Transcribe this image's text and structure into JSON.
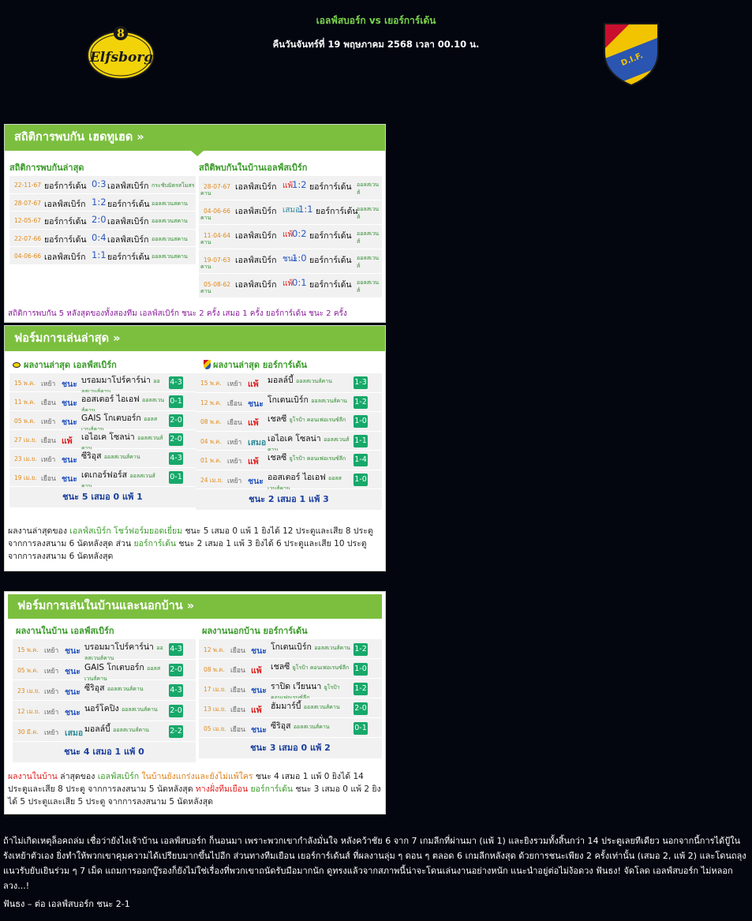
{
  "header": {
    "title": "เอลฟ์สบอร์ก vs เยอร์การ์เด้น",
    "datetime": "คืนวันจันทร์ที่ 19 พฤษภาคม 2568 เวลา 00.10 น.",
    "home_logo": "elfsborg-crest",
    "away_logo": "djurgarden-dif-crest",
    "home_logo_text": "Elfsborg",
    "away_logo_text": "D.I.F."
  },
  "h2h": {
    "heading": "สถิติการพบกัน เฮดทูเฮด »",
    "left_title": "สถิติการพบกันล่าสุด",
    "right_title": "สถิติพบกันในบ้านเอลฟ์สเบิร์ก",
    "left_rows": [
      {
        "date": "22-11-67",
        "home": "ยอร์การ์เด้น",
        "score": "0:3",
        "away": "เอลฟ์สเบิร์ก",
        "comp": "กระชับมิตรสโมสร"
      },
      {
        "date": "28-07-67",
        "home": "เอลฟ์สเบิร์ก",
        "score": "1:2",
        "away": "ยอร์การ์เด้น",
        "comp": "ออลสเวนสคาน"
      },
      {
        "date": "12-05-67",
        "home": "ยอร์การ์เด้น",
        "score": "2:0",
        "away": "เอลฟ์สเบิร์ก",
        "comp": "ออลสเวนสคาน"
      },
      {
        "date": "22-07-66",
        "home": "ยอร์การ์เด้น",
        "score": "0:4",
        "away": "เอลฟ์สเบิร์ก",
        "comp": "ออลสเวนสคาน"
      },
      {
        "date": "04-06-66",
        "home": "เอลฟ์สเบิร์ก",
        "score": "1:1",
        "away": "ยอร์การ์เด้น",
        "comp": "ออลสเวนสคาน"
      }
    ],
    "right_rows": [
      {
        "date": "28-07-67",
        "home": "เอลฟ์สเบิร์ก",
        "result": "แพ้",
        "res": "loss",
        "score": "1:2",
        "away": "ยอร์การ์เด้น",
        "comp1": "ออลสเวนส์",
        "comp2": "คาน"
      },
      {
        "date": "04-06-66",
        "home": "เอลฟ์สเบิร์ก",
        "result": "เสมอ",
        "res": "draw",
        "score": "1:1",
        "away": "ยอร์การ์เด้น",
        "comp1": "ออลสเวนส์",
        "comp2": "คาน"
      },
      {
        "date": "11-04-64",
        "home": "เอลฟ์สเบิร์ก",
        "result": "แพ้",
        "res": "loss",
        "score": "0:2",
        "away": "ยอร์การ์เด้น",
        "comp1": "ออลสเวนส์",
        "comp2": "คาน"
      },
      {
        "date": "19-07-63",
        "home": "เอลฟ์สเบิร์ก",
        "result": "ชนะ",
        "res": "win",
        "score": "1:0",
        "away": "ยอร์การ์เด้น",
        "comp1": "ออลสเวนส์",
        "comp2": "คาน"
      },
      {
        "date": "05-08-62",
        "home": "เอลฟ์สเบิร์ก",
        "result": "แพ้",
        "res": "loss",
        "score": "0:1",
        "away": "ยอร์การ์เด้น",
        "comp1": "ออลสเวนส์",
        "comp2": "คาน"
      }
    ],
    "summary": "สถิติการพบกัน 5 หลังสุดของทั้งสองทีม เอลฟ์สเบิร์ก ชนะ 2 ครั้ง เสมอ 1 ครั้ง ยอร์การ์เด้น ชนะ 2 ครั้ง"
  },
  "form": {
    "heading": "ฟอร์มการเล่นล่าสุด »",
    "left_title": "ผลงานล่าสุด เอลฟ์สเบิร์ก",
    "right_title": "ผลงานล่าสุด ยอร์การ์เด้น",
    "left_rows": [
      {
        "date": "15 พ.ค.",
        "ha": "เหย้า",
        "result": "ชนะ",
        "res": "win",
        "opp": "บรอมมาโปร์คาร์น่า",
        "comp": "ออลสเวนส์คาน",
        "score": "4-3"
      },
      {
        "date": "11 พ.ค.",
        "ha": "เยือน",
        "result": "ชนะ",
        "res": "win",
        "opp": "ออสเตอร์ ไอเอฟ",
        "comp": "ออลสเวนส์คาน",
        "score": "0-1"
      },
      {
        "date": "05 พ.ค.",
        "ha": "เหย้า",
        "result": "ชนะ",
        "res": "win",
        "opp": "GAIS โกเตบอร์ก",
        "comp": "ออลสเวนส์คาน",
        "score": "2-0"
      },
      {
        "date": "27 เม.ย.",
        "ha": "เยือน",
        "result": "แพ้",
        "res": "loss",
        "opp": "เอไอเค โซลน่า",
        "comp": "ออลสเวนส์คาน",
        "score": "2-0"
      },
      {
        "date": "23 เม.ย.",
        "ha": "เหย้า",
        "result": "ชนะ",
        "res": "win",
        "opp": "ซีริอุส",
        "comp": "ออลสเวนส์คาน",
        "score": "4-3"
      },
      {
        "date": "19 เม.ย.",
        "ha": "เยือน",
        "result": "ชนะ",
        "res": "win",
        "opp": "เดเกอร์ฟอร์ส",
        "comp": "ออลสเวนส์คาน",
        "score": "0-1"
      }
    ],
    "right_rows": [
      {
        "date": "15 พ.ค.",
        "ha": "เหย้า",
        "result": "แพ้",
        "res": "loss",
        "opp": "มอลล์บี้",
        "comp": "ออลสเวนส์คาน",
        "score": "1-3"
      },
      {
        "date": "12 พ.ค.",
        "ha": "เยือน",
        "result": "ชนะ",
        "res": "win",
        "opp": "โกเตนเบิร์ก",
        "comp": "ออลสเวนส์คาน",
        "score": "1-2"
      },
      {
        "date": "08 พ.ค.",
        "ha": "เยือน",
        "result": "แพ้",
        "res": "loss",
        "opp": "เชลซี",
        "comp": "ยูโรป้า คอนเฟอเรนซ์ลีก",
        "score": "1-0"
      },
      {
        "date": "04 พ.ค.",
        "ha": "เหย้า",
        "result": "เสมอ",
        "res": "draw",
        "opp": "เอไอเค โซลน่า",
        "comp": "ออลสเวนส์คาน",
        "score": "1-1"
      },
      {
        "date": "01 พ.ค.",
        "ha": "เหย้า",
        "result": "แพ้",
        "res": "loss",
        "opp": "เชลซี",
        "comp": "ยูโรป้า คอนเฟอเรนซ์ลีก",
        "score": "1-4"
      },
      {
        "date": "24 เม.ย.",
        "ha": "เหย้า",
        "result": "ชนะ",
        "res": "win",
        "opp": "ออสเตอร์ ไอเอฟ",
        "comp": "ออลสเวนส์คาน",
        "score": "1-0"
      }
    ],
    "left_total": "ชนะ 5 เสมอ 0 แพ้ 1",
    "right_total": "ชนะ 2 เสมอ 1 แพ้ 3",
    "summary_p1": "ผลงานล่าสุดของ ",
    "summary_team1": "เอลฟ์สเบิร์ก โชว์ฟอร์มยอดเยี่ยม",
    "summary_p2": " ชนะ 5 เสมอ 0 แพ้ 1 ยิงได้ 12 ประตูและเสีย 8 ประตู จากการลงสนาม 6 นัดหลังสุด ส่วน ",
    "summary_team2": "ยอร์การ์เด้น",
    "summary_p3": " ชนะ 2 เสมอ 1 แพ้ 3 ยิงได้ 6 ประตูและเสีย 10 ประตู จากการลงสนาม 6 นัดหลังสุด"
  },
  "homeaway": {
    "heading": "ฟอร์มการเล่นในบ้านและนอกบ้าน »",
    "left_title": "ผลงานในบ้าน เอลฟ์สเบิร์ก",
    "right_title": "ผลงานนอกบ้าน ยอร์การ์เด้น",
    "left_rows": [
      {
        "date": "15 พ.ค.",
        "ha": "เหย้า",
        "result": "ชนะ",
        "res": "win",
        "opp": "บรอมมาโปร์คาร์น่า",
        "comp": "ออลสเวนส์คาน",
        "score": "4-3"
      },
      {
        "date": "05 พ.ค.",
        "ha": "เหย้า",
        "result": "ชนะ",
        "res": "win",
        "opp": "GAIS โกเตบอร์ก",
        "comp": "ออลสเวนส์คาน",
        "score": "2-0"
      },
      {
        "date": "23 เม.ย.",
        "ha": "เหย้า",
        "result": "ชนะ",
        "res": "win",
        "opp": "ซีริอุส",
        "comp": "ออลสเวนส์คาน",
        "score": "4-3"
      },
      {
        "date": "12 เม.ย.",
        "ha": "เหย้า",
        "result": "ชนะ",
        "res": "win",
        "opp": "นอร์โคปิง",
        "comp": "ออลสเวนส์คาน",
        "score": "2-0"
      },
      {
        "date": "30 มี.ค.",
        "ha": "เหย้า",
        "result": "เสมอ",
        "res": "draw",
        "opp": "มอลล์บี้",
        "comp": "ออลสเวนส์คาน",
        "score": "2-2"
      }
    ],
    "right_rows": [
      {
        "date": "12 พ.ค.",
        "ha": "เยือน",
        "result": "ชนะ",
        "res": "win",
        "opp": "โกเตนเบิร์ก",
        "comp": "ออลสเวนส์คาน",
        "score": "1-2"
      },
      {
        "date": "08 พ.ค.",
        "ha": "เยือน",
        "result": "แพ้",
        "res": "loss",
        "opp": "เชลซี",
        "comp": "ยูโรป้า คอนเฟอเรนซ์ลีก",
        "score": "1-0"
      },
      {
        "date": "17 เม.ย.",
        "ha": "เยือน",
        "result": "ชนะ",
        "res": "win",
        "opp": "ราปิด เวียนนา",
        "comp": "ยูโรป้า คอนเฟอเรนซ์ลีก",
        "score": "1-2"
      },
      {
        "date": "13 เม.ย.",
        "ha": "เยือน",
        "result": "แพ้",
        "res": "loss",
        "opp": "ฮัมมาร์บี้",
        "comp": "ออลสเวนส์คาน",
        "score": "2-0"
      },
      {
        "date": "05 เม.ย.",
        "ha": "เยือน",
        "result": "ชนะ",
        "res": "win",
        "opp": "ซีริอุส",
        "comp": "ออลสเวนส์คาน",
        "score": "0-1"
      }
    ],
    "left_total": "ชนะ 4 เสมอ 1 แพ้ 0",
    "right_total": "ชนะ 3 เสมอ 0 แพ้ 2",
    "s_a": "ผลงานในบ้าน",
    "s_b": " ล่าสุดของ ",
    "s_c": "เอลฟ์สเบิร์ก",
    "s_d": " ในบ้านยังแกร่งและยังไม่แพ้ใคร",
    "s_e": " ชนะ 4 เสมอ 1 แพ้ 0 ยิงได้ 14 ประตูและเสีย 8 ประตู จากการลงสนาม 5 นัดหลังสุด ",
    "s_f": "ทางฝั่งทีมเยือน",
    "s_g": " ",
    "s_h": "ยอร์การ์เด้น",
    "s_i": " ชนะ 3 เสมอ 0 แพ้ 2 ยิงได้ 5 ประตูและเสีย 5 ประตู จากการลงสนาม 5 นัดหลังสุด"
  },
  "article": {
    "paragraph": "ถ้าไม่เกิดเหตุล็อคถล่ม เชื่อว่ายังไงเจ้าบ้าน เอลฟ์สบอร์ก ก็นอนมา เพราะพวกเขากำลังมั่นใจ หลังคว้าชัย 6 จาก 7 เกมลีกที่ผ่านมา (แพ้ 1) และยิงรวมทั้งสิ้นกว่า 14 ประตูเลยทีเดียว นอกจากนี้การได้ปู้ในรังเหย้าตัวเอง ยิ่งทำให้พวกเขาคุมความได้เปรียบมากขึ้นไปอีก ส่วนทางทีมเยือน เยอร์การ์เด้นส์ ที่ผลงานลุ่ม ๆ ดอน ๆ ตลอด 6 เกมลีกหลังสุด ด้วยการชนะเพียง 2 ครั้งเท่านั้น (เสมอ 2, แพ้ 2) และโดนถลุงแนวรับยับเยินร่วม ๆ 7 เม็ด แถมการออกบู๊รองก็ยังไม่ใช่เรื่องที่พวกเขาถนัดรับมือมากนัก ดูทรงแล้วจากสภาพนี้น่าจะโดนเล่นงานอย่างหนัก แนะนำอยู่ต่อไม่ง้อดวง ฟันธง! จัดโลด เอลฟ์สบอร์ก ไม่หลอกลวง...!",
    "prediction": "ฟันธง – ต่อ เอลฟ์สบอร์ก ชนะ 2-1"
  },
  "colors": {
    "green": "#7cbf3f",
    "win": "#2b58c2",
    "loss": "#e02020",
    "draw": "#2e8b9a",
    "badge": "#17a86a",
    "date": "#e08a1c"
  }
}
